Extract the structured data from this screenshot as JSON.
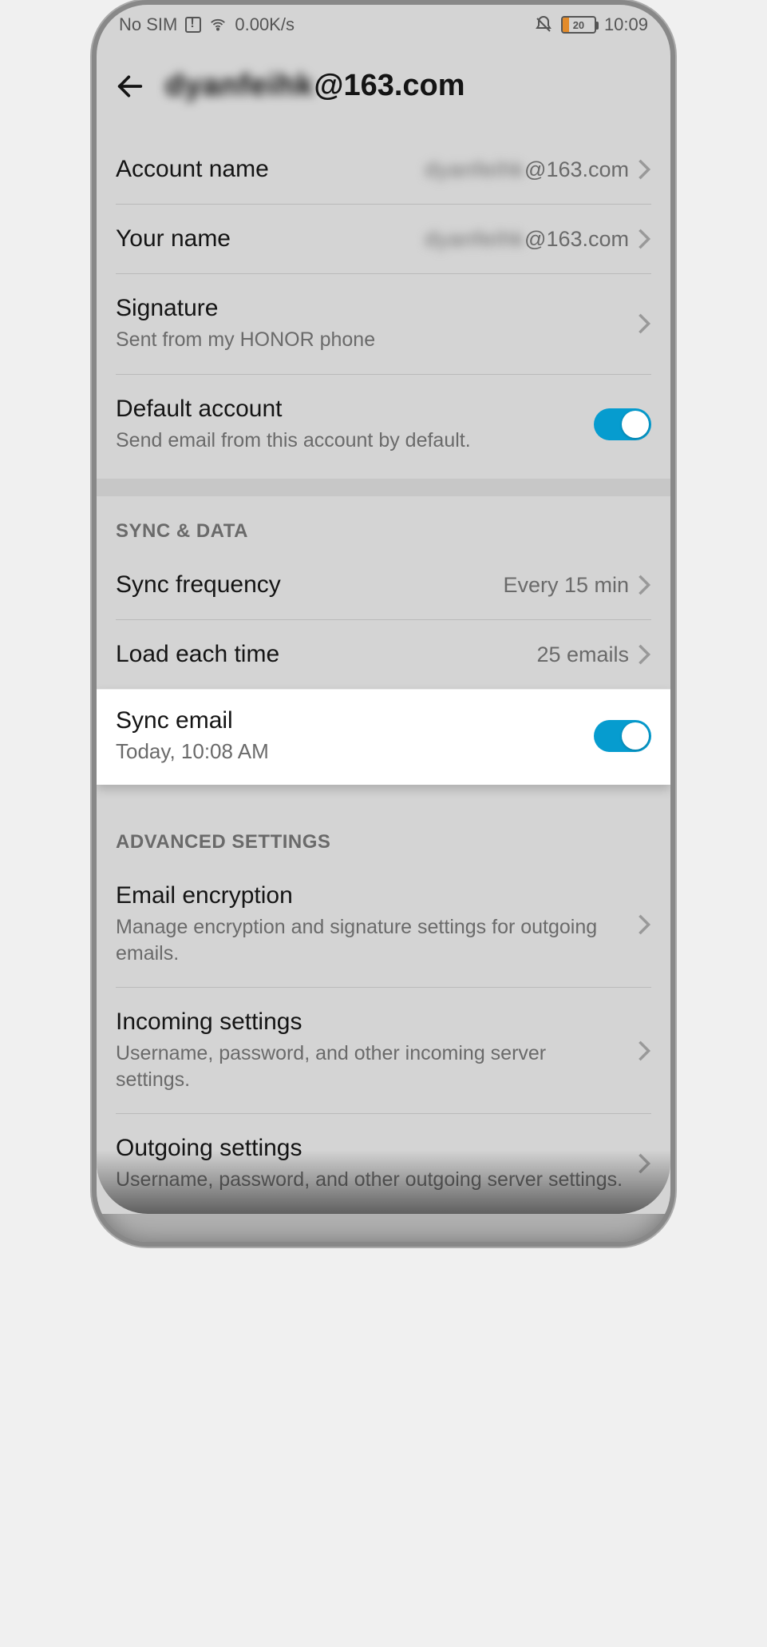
{
  "status": {
    "sim": "No SIM",
    "speed": "0.00K/s",
    "battery": "20",
    "time": "10:09"
  },
  "header": {
    "title_prefix": "dyanfeihk",
    "title_suffix": "@163.com"
  },
  "account": {
    "name_label": "Account name",
    "name_value_prefix": "dyanfeihk",
    "name_value_suffix": "@163.com",
    "your_name_label": "Your name",
    "your_name_value_prefix": "dyanfeihk",
    "your_name_value_suffix": "@163.com",
    "signature_label": "Signature",
    "signature_value": "Sent from my HONOR phone",
    "default_label": "Default account",
    "default_sub": "Send email from this account by default.",
    "default_on": true
  },
  "sync": {
    "header": "SYNC & DATA",
    "freq_label": "Sync frequency",
    "freq_value": "Every 15 min",
    "load_label": "Load each time",
    "load_value": "25 emails",
    "sync_email_label": "Sync email",
    "sync_email_sub": "Today, 10:08 AM",
    "sync_email_on": true
  },
  "advanced": {
    "header": "ADVANCED SETTINGS",
    "encryption_label": "Email encryption",
    "encryption_sub": "Manage encryption and signature settings for outgoing emails.",
    "incoming_label": "Incoming settings",
    "incoming_sub": "Username, password, and other incoming server settings.",
    "outgoing_label": "Outgoing settings",
    "outgoing_sub": "Username, password, and other outgoing server settings."
  }
}
